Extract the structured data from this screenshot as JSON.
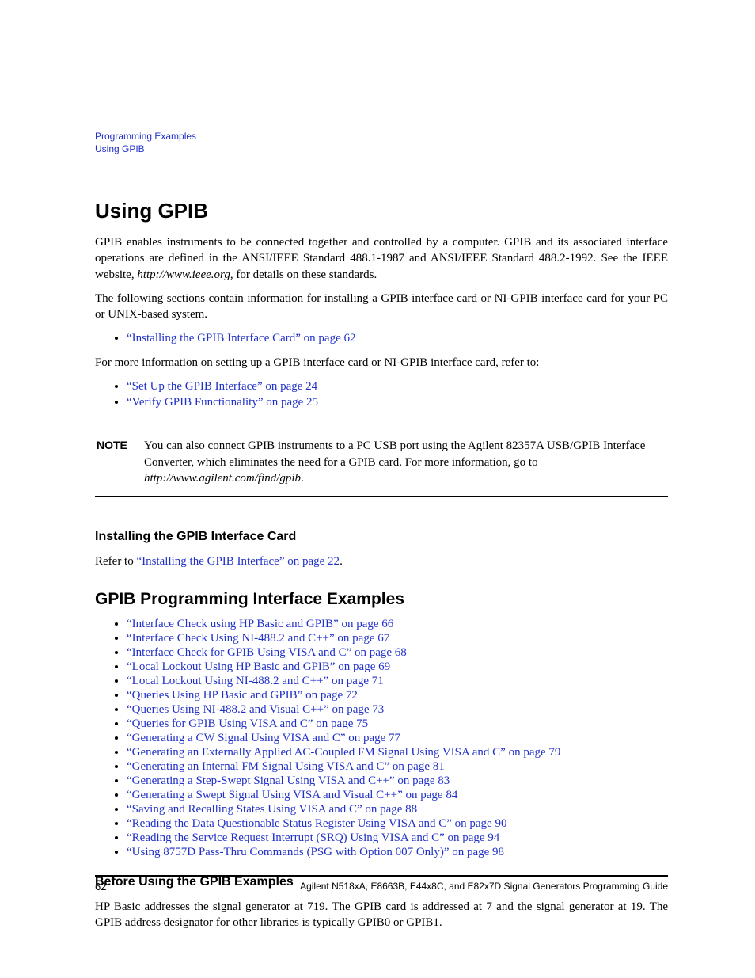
{
  "header": {
    "line1": "Programming Examples",
    "line2": "Using GPIB"
  },
  "h1": "Using GPIB",
  "intro": {
    "p1a": "GPIB enables instruments to be connected together and controlled by a computer. GPIB and its associated interface operations are defined in the ANSI/IEEE Standard 488.1-1987 and ANSI/IEEE Standard 488.2-1992. See the IEEE website, ",
    "p1url": "http://www.ieee.org",
    "p1b": ", for details on these standards.",
    "p2": "The following sections contain information for installing a GPIB interface card or NI-GPIB interface card for your PC or UNIX-based system."
  },
  "list1": [
    "“Installing the GPIB Interface Card” on page 62"
  ],
  "mid": "For more information on setting up a GPIB interface card or NI-GPIB interface card, refer to:",
  "list2": [
    "“Set Up the GPIB Interface” on page 24",
    "“Verify GPIB Functionality” on page 25"
  ],
  "note": {
    "label": "NOTE",
    "text_a": "You can also connect GPIB instruments to a PC USB port using the Agilent 82357A USB/GPIB Interface Converter, which eliminates the need for a GPIB card. For more information, go to ",
    "text_url": "http://www.agilent.com/find/gpib",
    "text_b": "."
  },
  "install": {
    "heading": "Installing the GPIB Interface Card",
    "text_a": "Refer to ",
    "link": "“Installing the GPIB Interface” on page 22",
    "text_b": "."
  },
  "examples_heading": "GPIB Programming Interface Examples",
  "examples": [
    "“Interface Check using HP Basic and GPIB” on page 66",
    "“Interface Check Using NI-488.2 and C++” on page 67",
    "“Interface Check for GPIB Using VISA and C” on page 68",
    "“Local Lockout Using HP Basic and GPIB” on page 69",
    "“Local Lockout Using NI-488.2 and C++” on page 71",
    "“Queries Using HP Basic and GPIB” on page 72",
    "“Queries Using NI-488.2 and Visual C++” on page 73",
    "“Queries for GPIB Using VISA and C” on page 75",
    "“Generating a CW Signal Using VISA and C” on page 77",
    "“Generating an Externally Applied AC-Coupled FM Signal Using VISA and C” on page 79",
    "“Generating an Internal FM Signal Using VISA and C” on page 81",
    "“Generating a Step-Swept Signal Using VISA and C++” on page 83",
    "“Generating a Swept Signal Using VISA and Visual C++” on page 84",
    "“Saving and Recalling States Using VISA and C” on page 88",
    "“Reading the Data Questionable Status Register Using VISA and C” on page 90",
    "“Reading the Service Request Interrupt (SRQ) Using VISA and C” on page 94",
    "“Using 8757D Pass-Thru Commands (PSG with Option 007 Only)” on page 98"
  ],
  "before": {
    "heading": "Before Using the GPIB Examples",
    "text": "HP Basic addresses the signal generator at 719. The GPIB card is addressed at 7 and the signal generator at 19. The GPIB address designator for other libraries is typically GPIB0 or GPIB1."
  },
  "footer": {
    "page": "62",
    "title": "Agilent N518xA, E8663B, E44x8C, and E82x7D Signal Generators Programming Guide"
  }
}
